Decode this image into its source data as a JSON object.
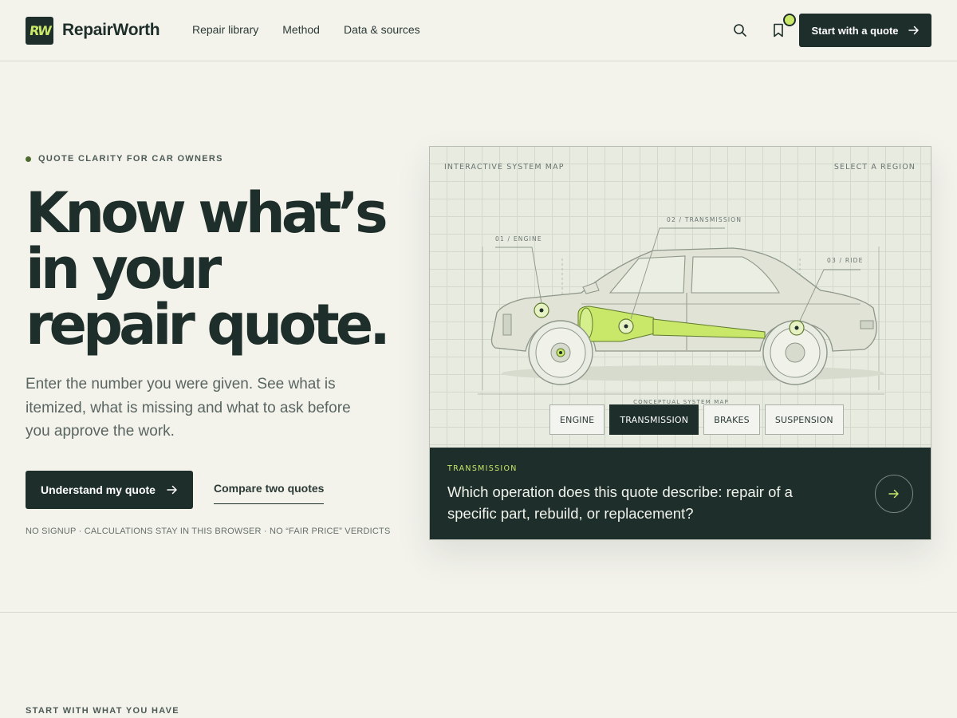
{
  "header": {
    "logo_text": "RW",
    "brand": "RepairWorth",
    "nav": [
      "Repair library",
      "Method",
      "Data & sources"
    ],
    "cta": "Start with a quote"
  },
  "hero": {
    "eyebrow": "QUOTE CLARITY FOR CAR OWNERS",
    "headline": [
      "Know what’s",
      "in your",
      "repair quote."
    ],
    "lede": "Enter the number you were given. See what is itemized, what is missing and what to ask before you approve the work.",
    "primary_button": "Understand my quote",
    "secondary_link": "Compare two quotes",
    "fineprint": "NO SIGNUP · CALCULATIONS STAY IN THIS BROWSER · NO “FAIR PRICE” VERDICTS"
  },
  "system_map": {
    "label_left": "INTERACTIVE SYSTEM MAP",
    "label_right": "SELECT A REGION",
    "callouts": [
      "01 / ENGINE",
      "02 / TRANSMISSION",
      "03 / RIDE"
    ],
    "caption": "CONCEPTUAL SYSTEM MAP",
    "tabs": [
      "ENGINE",
      "TRANSMISSION",
      "BRAKES",
      "SUSPENSION"
    ],
    "active_tab": "TRANSMISSION",
    "footer_eyebrow": "TRANSMISSION",
    "footer_question": "Which operation does this quote describe: repair of a specific part, rebuild, or replacement?"
  },
  "section": {
    "eyebrow": "START WITH WHAT YOU HAVE"
  },
  "colors": {
    "ink": "#1e2e2a",
    "accent": "#c9e86a",
    "background": "#f3f3ec"
  },
  "icons": [
    "search-icon",
    "bookmark-icon",
    "arrow-right-icon"
  ]
}
